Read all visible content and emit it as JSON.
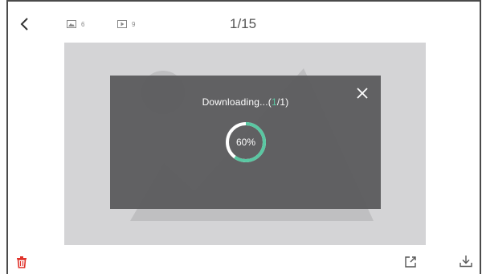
{
  "header": {
    "image_count": "6",
    "video_count": "9",
    "pager": "1/15"
  },
  "dialog": {
    "text_prefix": "Downloading...(",
    "current": "1",
    "text_suffix": "/1)",
    "progress": 0.6,
    "progress_label": "60%"
  },
  "colors": {
    "accent": "#5ac7a2",
    "delete": "#e0332b",
    "overlay": "#58585a",
    "placeholder": "#d4d4d6"
  },
  "icons": {
    "back": "chevron-left-icon",
    "image_count": "image-icon",
    "video_count": "play-icon",
    "close": "close-icon",
    "delete": "trash-icon",
    "share": "share-icon",
    "download": "download-icon",
    "placeholder": "image-placeholder-icon"
  }
}
